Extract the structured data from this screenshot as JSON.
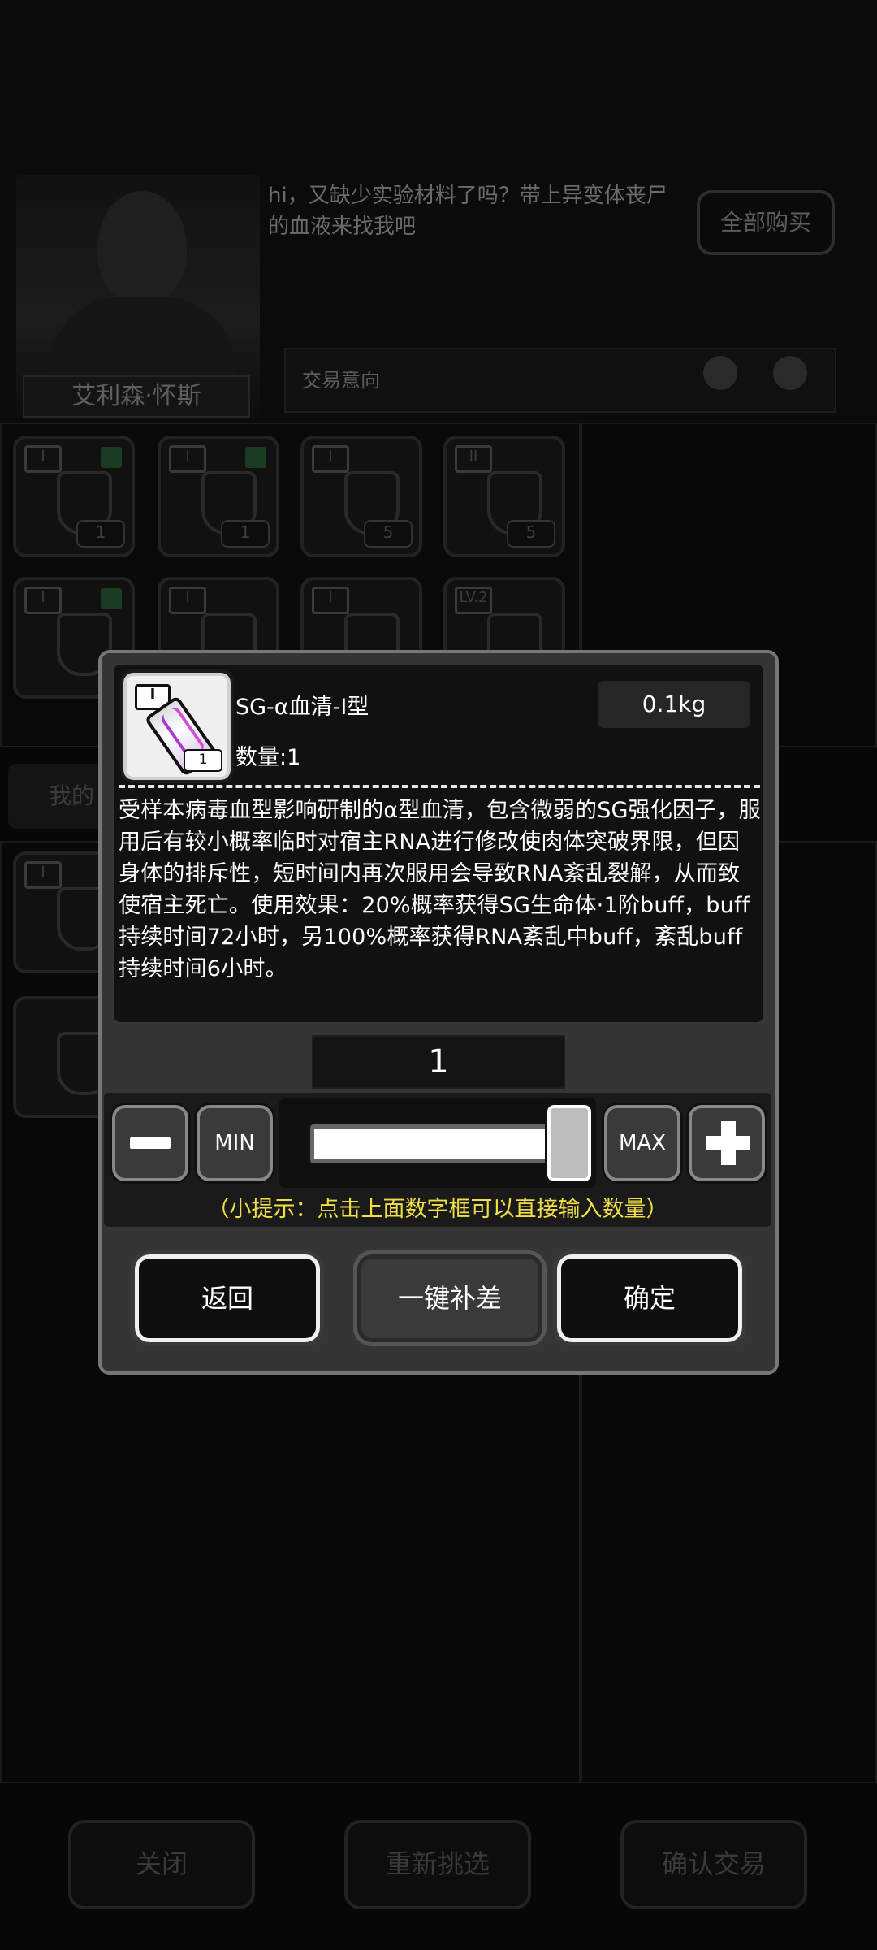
{
  "npc": {
    "name": "艾利森·怀斯",
    "speech": "hi，又缺少实验材料了吗？带上异变体丧尸的血液来找我吧",
    "buy_all_label": "全部购买",
    "trade_intent_label": "交易意向"
  },
  "shop_slots": [
    {
      "tier": "I",
      "icon": "chip-icon",
      "count": "1"
    },
    {
      "tier": "I",
      "icon": "circuit-board-icon",
      "count": "1"
    },
    {
      "tier": "I",
      "icon": "flask-icon",
      "count": "5"
    },
    {
      "tier": "II",
      "icon": "flask-icon",
      "count": "5"
    },
    {
      "tier": "I",
      "icon": "syringe-icon",
      "count": ""
    },
    {
      "tier": "I",
      "icon": "grid-icon",
      "count": ""
    },
    {
      "tier": "I",
      "icon": "beaker-icon",
      "count": ""
    },
    {
      "tier": "LV.2",
      "icon": "map-icon",
      "count": ""
    }
  ],
  "my_tab_label": "我的",
  "bottom_buttons": {
    "close": "关闭",
    "reselect": "重新挑选",
    "confirm_trade": "确认交易"
  },
  "dialog": {
    "item": {
      "tier": "I",
      "icon": "serum-vial-icon",
      "icon_count": "1",
      "name": "SG-α血清-Ⅰ型",
      "qty_label": "数量:1",
      "weight": "0.1kg",
      "description": "受样本病毒血型影响研制的α型血清，包含微弱的SG强化因子，服用后有较小概率临时对宿主RNA进行修改使肉体突破界限，但因身体的排斥性，短时间内再次服用会导致RNA紊乱裂解，从而致使宿主死亡。使用效果：20%概率获得SG生命体·1阶buff，buff持续时间72小时，另100%概率获得RNA紊乱中buff，紊乱buff持续时间6小时。"
    },
    "quantity": "1",
    "slider_fraction": 1.0,
    "min_label": "MIN",
    "max_label": "MAX",
    "hint": "（小提示：点击上面数字框可以直接输入数量）",
    "buttons": {
      "back": "返回",
      "fill_gap": "一键补差",
      "confirm": "确定"
    },
    "colors": {
      "hint": "#f1df46",
      "panel": "#353535",
      "border": "#777777"
    }
  }
}
